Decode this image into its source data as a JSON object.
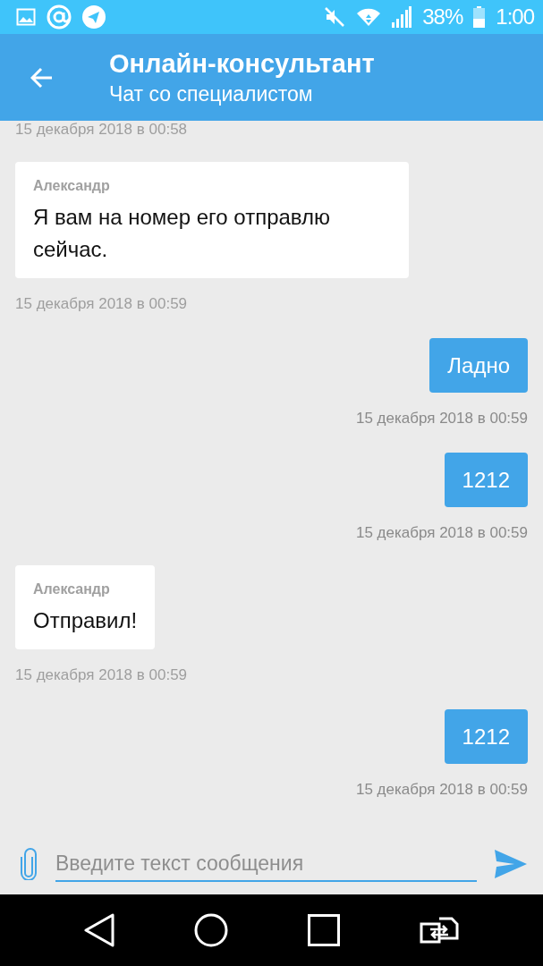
{
  "status_bar": {
    "battery_text": "38%",
    "time": "1:00"
  },
  "header": {
    "title": "Онлайн-консультант",
    "subtitle": "Чат со специалистом"
  },
  "messages": [
    {
      "kind": "time",
      "time": "15 декабря 2018 в 00:58"
    },
    {
      "kind": "incoming",
      "author": "Александр",
      "text": "Я вам на номер его отправлю сейчас.",
      "time": "15 декабря 2018 в 00:59"
    },
    {
      "kind": "outgoing",
      "text": "Ладно",
      "time": "15 декабря 2018 в 00:59"
    },
    {
      "kind": "outgoing",
      "text": "1212",
      "time": "15 декабря 2018 в 00:59"
    },
    {
      "kind": "incoming",
      "author": "Александр",
      "text": "Отправил!",
      "time": "15 декабря 2018 в 00:59"
    },
    {
      "kind": "outgoing",
      "text": "1212",
      "time": "15 декабря 2018 в 00:59"
    }
  ],
  "composer": {
    "placeholder": "Введите текст сообщения"
  }
}
